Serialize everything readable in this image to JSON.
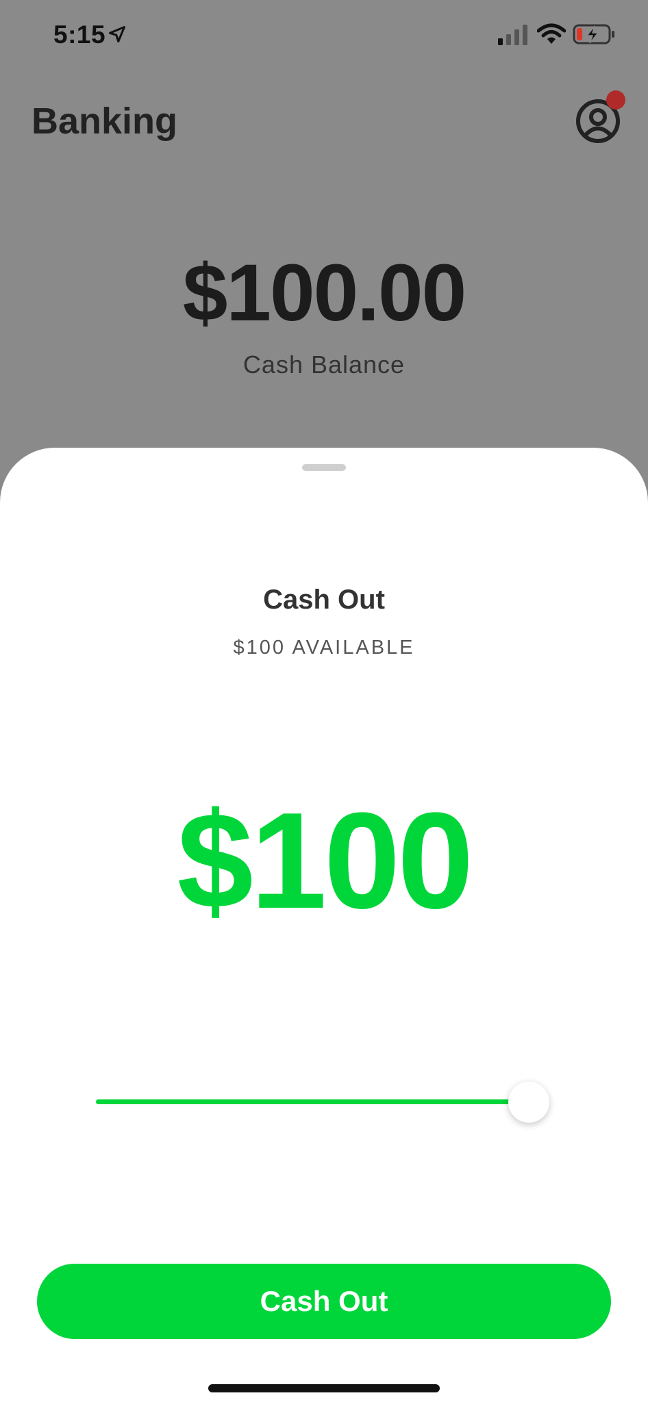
{
  "status_bar": {
    "time": "5:15",
    "icons": [
      "location-arrow-icon",
      "cellular-signal-icon",
      "wifi-icon",
      "battery-charging-icon"
    ],
    "battery_color": "#e0352b"
  },
  "header": {
    "title": "Banking",
    "profile_icon": "profile-icon",
    "notification_color": "#b02a2a"
  },
  "balance": {
    "amount": "$100.00",
    "label": "Cash Balance"
  },
  "sheet": {
    "title": "Cash Out",
    "available": "$100 AVAILABLE",
    "amount": "$100",
    "slider_value_fraction": 1.0,
    "button_label": "Cash Out",
    "accent_color": "#00d639"
  }
}
